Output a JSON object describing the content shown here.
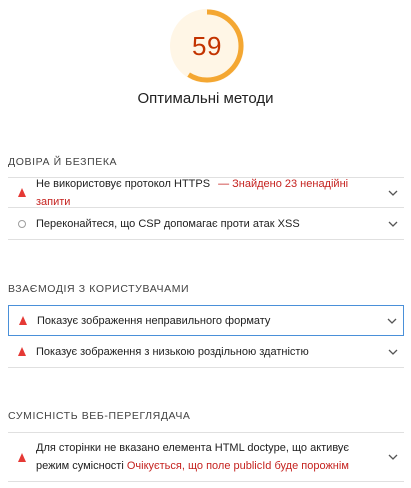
{
  "category": {
    "score": "59",
    "score_fraction": 0.59,
    "score_color": "#f4a732",
    "title": "Оптимальні методи"
  },
  "groups": [
    {
      "heading": "Довіра й безпека",
      "audits": [
        {
          "status": "fail",
          "title": "Не використовує протокол HTTPS",
          "display_value": "— Знайдено 23 ненадійні запити"
        },
        {
          "status": "info",
          "title": "Переконайтеся, що CSP допомагає проти атак XSS",
          "display_value": ""
        }
      ]
    },
    {
      "heading": "Взаємодія з користувачами",
      "audits": [
        {
          "status": "fail",
          "title": "Показує зображення неправильного формату",
          "display_value": ""
        },
        {
          "status": "fail",
          "title": "Показує зображення з низькою роздільною здатністю",
          "display_value": ""
        }
      ]
    },
    {
      "heading": "Сумісність веб-переглядача",
      "audits": [
        {
          "status": "fail",
          "title": "Для сторінки не вказано елемента HTML doctype, що активує режим сумісності",
          "warning": "Очікується, що поле publicId буде порожнім"
        }
      ]
    }
  ],
  "colors": {
    "fail": "#e53935",
    "warning_text": "#c5221f",
    "focus_border": "#4a90d9"
  },
  "icons": {
    "fail": "triangle-warning-icon",
    "info": "circle-icon",
    "expand": "chevron-down-icon"
  }
}
